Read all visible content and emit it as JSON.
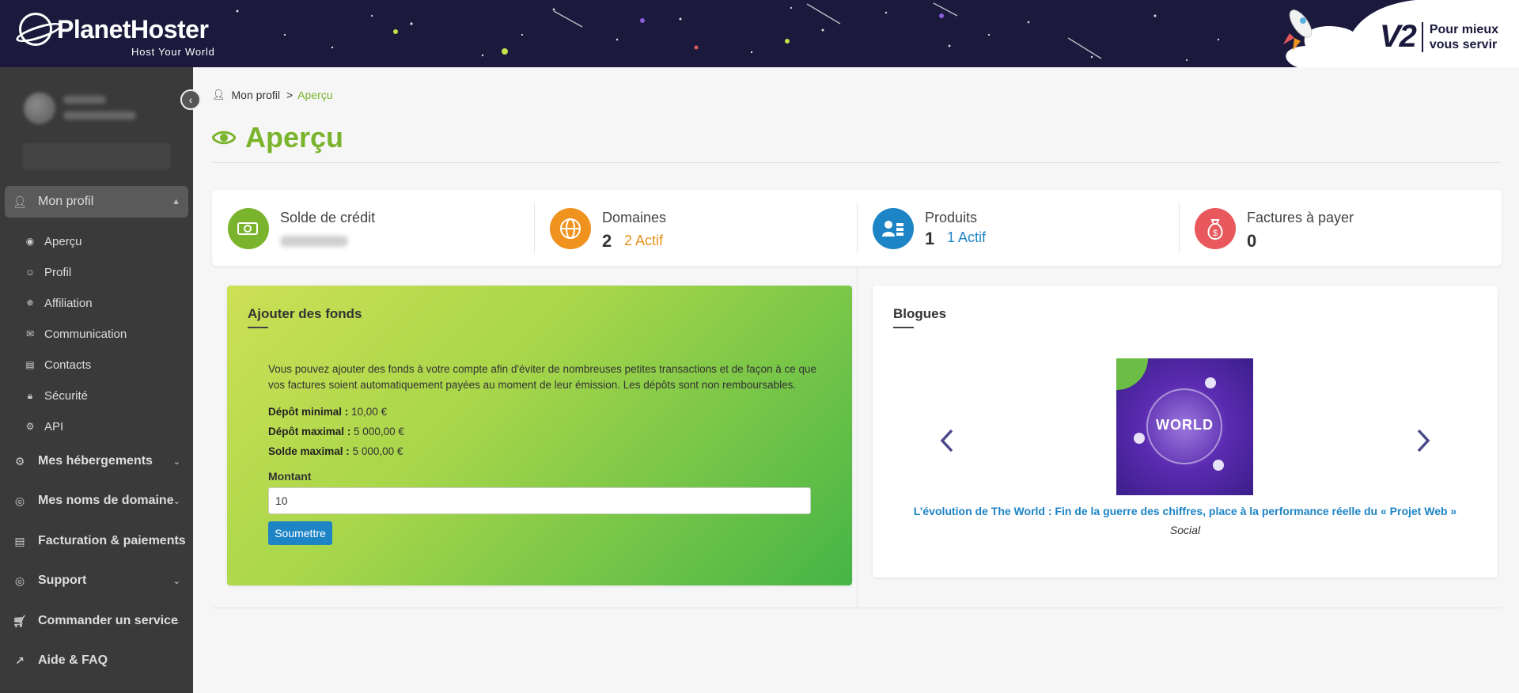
{
  "header": {
    "logo_text": "PlanetHoster",
    "logo_tagline": "Host Your World",
    "v2_badge": "V2",
    "v2_line1": "Pour mieux",
    "v2_line2": "vous servir"
  },
  "sidebar": {
    "collapse_icon": "chevron-left-icon",
    "sections": [
      {
        "label": "Mon profil",
        "icon": "user-icon",
        "active": true,
        "expanded": true
      },
      {
        "label": "Mes hébergements",
        "icon": "server-icon"
      },
      {
        "label": "Mes noms de domaine",
        "icon": "domain-icon"
      },
      {
        "label": "Facturation & paiements",
        "icon": "invoice-icon"
      },
      {
        "label": "Support",
        "icon": "support-icon"
      },
      {
        "label": "Commander un service",
        "icon": "cart-icon"
      },
      {
        "label": "Aide & FAQ",
        "icon": "external-link-icon"
      }
    ],
    "profile_items": [
      {
        "label": "Aperçu",
        "icon": "eye-icon"
      },
      {
        "label": "Profil",
        "icon": "face-icon"
      },
      {
        "label": "Affiliation",
        "icon": "network-icon"
      },
      {
        "label": "Communication",
        "icon": "envelope-icon"
      },
      {
        "label": "Contacts",
        "icon": "contacts-icon"
      },
      {
        "label": "Sécurité",
        "icon": "lock-icon"
      },
      {
        "label": "API",
        "icon": "api-icon"
      }
    ]
  },
  "breadcrumb": {
    "root": "Mon profil",
    "separator": ">",
    "current": "Aperçu"
  },
  "page": {
    "title": "Aperçu",
    "accent": "#7ab42c"
  },
  "stats": [
    {
      "label": "Solde de crédit",
      "value": "",
      "icon": "money-icon",
      "color": "#7ab42c"
    },
    {
      "label": "Domaines",
      "value": "2",
      "sub": "2 Actif",
      "sub_color": "#e8921c",
      "icon": "globe-icon",
      "color": "#f0921e"
    },
    {
      "label": "Produits",
      "value": "1",
      "sub": "1 Actif",
      "sub_color": "#1d84c6",
      "icon": "products-icon",
      "color": "#1d84c6"
    },
    {
      "label": "Factures à payer",
      "value": "0",
      "icon": "money-bag-icon",
      "color": "#e8585c"
    }
  ],
  "funds": {
    "title": "Ajouter des fonds",
    "description": "Vous pouvez ajouter des fonds à votre compte afin d'éviter de nombreuses petites transactions et de façon à ce que vos factures soient automatiquement payées au moment de leur émission. Les dépôts sont non remboursables.",
    "min_label": "Dépôt minimal :",
    "min_value": "10,00 €",
    "max_label": "Dépôt maximal :",
    "max_value": "5 000,00 €",
    "balance_label": "Solde maximal :",
    "balance_value": "5 000,00 €",
    "amount_label": "Montant",
    "amount_value": "10",
    "submit_label": "Soumettre"
  },
  "blogs": {
    "title": "Blogues",
    "image_text": "WORLD",
    "post_title": "L’évolution de The World : Fin de la guerre des chiffres, place à la performance réelle du « Projet Web »",
    "post_category": "Social",
    "prev_icon": "chevron-left-icon",
    "next_icon": "chevron-right-icon"
  }
}
